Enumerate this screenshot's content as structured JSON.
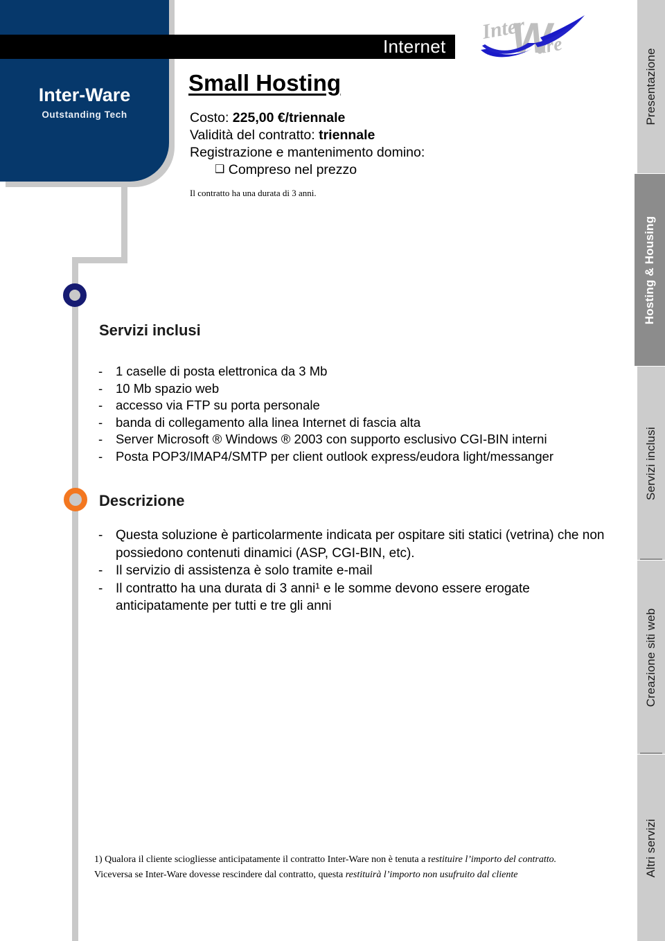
{
  "brand": {
    "name": "Inter-Ware",
    "tagline": "Outstanding Tech",
    "logo_icon": "inter-ware-swoosh-logo"
  },
  "header": {
    "band_label": "Internet",
    "slide_title": "Small Hosting"
  },
  "offer": {
    "cost_label": "Costo:",
    "cost_value": "225,00 €/triennale",
    "validity_label": "Validità del contratto:",
    "validity_value": "triennale",
    "domain_label": "Registrazione e mantenimento domino:",
    "domain_option_glyph": "❑",
    "domain_option": "Compreso nel prezzo",
    "note": "Il contratto ha una durata di 3 anni."
  },
  "sections": [
    {
      "id": "servizi-inclusi",
      "heading": "Servizi inclusi",
      "marker_icon": "ring-marker-icon",
      "marker_color": "#161b72",
      "bullet_dash": "-",
      "items": [
        "1 caselle di posta elettronica da 3 Mb",
        "10 Mb spazio web",
        "accesso via FTP su porta personale",
        "banda di collegamento alla linea Internet di fascia alta",
        "Server Microsoft ® Windows ® 2003 con supporto esclusivo CGI-BIN interni",
        "Posta POP3/IMAP4/SMTP per client outlook express/eudora light/messanger"
      ]
    },
    {
      "id": "descrizione",
      "heading": "Descrizione",
      "marker_icon": "ring-marker-icon",
      "marker_color": "#f37720",
      "bullet_dash": "-",
      "items": [
        "Questa soluzione è particolarmente indicata per ospitare siti statici (vetrina) che non possiedono contenuti dinamici (ASP, CGI-BIN, etc).",
        "Il servizio di assistenza è solo tramite e-mail",
        "Il contratto ha una durata di 3 anni¹ e le somme devono essere erogate anticipatamente per tutti e tre gli anni"
      ]
    }
  ],
  "footnote": {
    "line1_plain": "1) Qualora il cliente sciogliesse anticipatamente il contratto Inter-Ware non è tenuta a r",
    "line1_italic": "estituire l’importo del contratto.",
    "line2_plain": "Viceversa se Inter-Ware dovesse rescindere dal contratto, questa ",
    "line2_italic": "restituirà l’importo non usufruito dal cliente"
  },
  "sidebar": {
    "tabs": [
      {
        "label": "Presentazione",
        "active": false
      },
      {
        "label": "Hosting & Housing",
        "active": true
      },
      {
        "label": "Servizi inclusi",
        "active": false
      },
      {
        "label": "Creazione siti web",
        "active": false
      },
      {
        "label": "Altri servizi",
        "active": false
      }
    ]
  },
  "colors": {
    "brand_blue": "#06386b",
    "rail_gray": "#c9c9c9",
    "accent_orange": "#f37720",
    "accent_navy": "#161b72",
    "tab_inactive": "#cccccc",
    "tab_active": "#8c8c8c"
  }
}
